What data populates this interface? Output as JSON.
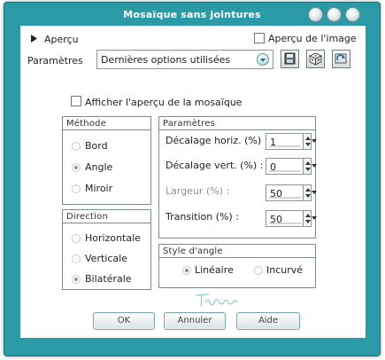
{
  "window": {
    "title": "Mosaïque sans jointures"
  },
  "preview": {
    "toggle_label": "Aperçu",
    "image_preview_label": "Aperçu de l'image",
    "image_preview_checked": false
  },
  "params": {
    "label": "Paramètres",
    "preset_value": "Dernières options utilisées"
  },
  "mosaic_preview": {
    "label": "Afficher l'aperçu de la mosaïque",
    "checked": false
  },
  "method": {
    "title": "Méthode",
    "options": [
      "Bord",
      "Angle",
      "Miroir"
    ],
    "selected": "Angle"
  },
  "direction": {
    "title": "Direction",
    "options": [
      "Horizontale",
      "Verticale",
      "Bilatérale"
    ],
    "selected": "Bilatérale"
  },
  "parameters": {
    "title": "Paramètres",
    "fields": [
      {
        "label": "Décalage horiz. (%) :",
        "value": "1",
        "enabled": true
      },
      {
        "label": "Décalage vert. (%) :",
        "value": "0",
        "enabled": true
      },
      {
        "label": "Largeur (%) :",
        "value": "50",
        "enabled": false
      },
      {
        "label": "Transition (%) :",
        "value": "50",
        "enabled": true
      }
    ]
  },
  "corner_style": {
    "title": "Style d'angle",
    "options": [
      "Linéaire",
      "Incurvé"
    ],
    "selected": "Linéaire"
  },
  "footer": {
    "ok_label": "OK",
    "cancel_label": "Annuler",
    "help_label": "Aide"
  },
  "colors": {
    "frame": "#2a9aa6",
    "client": "#ffffff"
  },
  "icons": {
    "save": "save-icon",
    "random": "dice-icon",
    "reset": "reset-icon",
    "expand": "triangle-right-icon"
  }
}
